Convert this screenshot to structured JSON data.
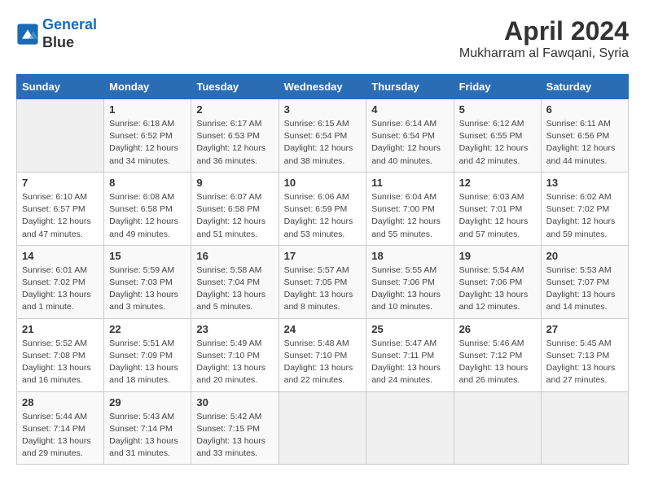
{
  "header": {
    "logo_line1": "General",
    "logo_line2": "Blue",
    "month": "April 2024",
    "location": "Mukharram al Fawqani, Syria"
  },
  "columns": [
    "Sunday",
    "Monday",
    "Tuesday",
    "Wednesday",
    "Thursday",
    "Friday",
    "Saturday"
  ],
  "weeks": [
    [
      {
        "day": "",
        "info": ""
      },
      {
        "day": "1",
        "info": "Sunrise: 6:18 AM\nSunset: 6:52 PM\nDaylight: 12 hours\nand 34 minutes."
      },
      {
        "day": "2",
        "info": "Sunrise: 6:17 AM\nSunset: 6:53 PM\nDaylight: 12 hours\nand 36 minutes."
      },
      {
        "day": "3",
        "info": "Sunrise: 6:15 AM\nSunset: 6:54 PM\nDaylight: 12 hours\nand 38 minutes."
      },
      {
        "day": "4",
        "info": "Sunrise: 6:14 AM\nSunset: 6:54 PM\nDaylight: 12 hours\nand 40 minutes."
      },
      {
        "day": "5",
        "info": "Sunrise: 6:12 AM\nSunset: 6:55 PM\nDaylight: 12 hours\nand 42 minutes."
      },
      {
        "day": "6",
        "info": "Sunrise: 6:11 AM\nSunset: 6:56 PM\nDaylight: 12 hours\nand 44 minutes."
      }
    ],
    [
      {
        "day": "7",
        "info": "Sunrise: 6:10 AM\nSunset: 6:57 PM\nDaylight: 12 hours\nand 47 minutes."
      },
      {
        "day": "8",
        "info": "Sunrise: 6:08 AM\nSunset: 6:58 PM\nDaylight: 12 hours\nand 49 minutes."
      },
      {
        "day": "9",
        "info": "Sunrise: 6:07 AM\nSunset: 6:58 PM\nDaylight: 12 hours\nand 51 minutes."
      },
      {
        "day": "10",
        "info": "Sunrise: 6:06 AM\nSunset: 6:59 PM\nDaylight: 12 hours\nand 53 minutes."
      },
      {
        "day": "11",
        "info": "Sunrise: 6:04 AM\nSunset: 7:00 PM\nDaylight: 12 hours\nand 55 minutes."
      },
      {
        "day": "12",
        "info": "Sunrise: 6:03 AM\nSunset: 7:01 PM\nDaylight: 12 hours\nand 57 minutes."
      },
      {
        "day": "13",
        "info": "Sunrise: 6:02 AM\nSunset: 7:02 PM\nDaylight: 12 hours\nand 59 minutes."
      }
    ],
    [
      {
        "day": "14",
        "info": "Sunrise: 6:01 AM\nSunset: 7:02 PM\nDaylight: 13 hours\nand 1 minute."
      },
      {
        "day": "15",
        "info": "Sunrise: 5:59 AM\nSunset: 7:03 PM\nDaylight: 13 hours\nand 3 minutes."
      },
      {
        "day": "16",
        "info": "Sunrise: 5:58 AM\nSunset: 7:04 PM\nDaylight: 13 hours\nand 5 minutes."
      },
      {
        "day": "17",
        "info": "Sunrise: 5:57 AM\nSunset: 7:05 PM\nDaylight: 13 hours\nand 8 minutes."
      },
      {
        "day": "18",
        "info": "Sunrise: 5:55 AM\nSunset: 7:06 PM\nDaylight: 13 hours\nand 10 minutes."
      },
      {
        "day": "19",
        "info": "Sunrise: 5:54 AM\nSunset: 7:06 PM\nDaylight: 13 hours\nand 12 minutes."
      },
      {
        "day": "20",
        "info": "Sunrise: 5:53 AM\nSunset: 7:07 PM\nDaylight: 13 hours\nand 14 minutes."
      }
    ],
    [
      {
        "day": "21",
        "info": "Sunrise: 5:52 AM\nSunset: 7:08 PM\nDaylight: 13 hours\nand 16 minutes."
      },
      {
        "day": "22",
        "info": "Sunrise: 5:51 AM\nSunset: 7:09 PM\nDaylight: 13 hours\nand 18 minutes."
      },
      {
        "day": "23",
        "info": "Sunrise: 5:49 AM\nSunset: 7:10 PM\nDaylight: 13 hours\nand 20 minutes."
      },
      {
        "day": "24",
        "info": "Sunrise: 5:48 AM\nSunset: 7:10 PM\nDaylight: 13 hours\nand 22 minutes."
      },
      {
        "day": "25",
        "info": "Sunrise: 5:47 AM\nSunset: 7:11 PM\nDaylight: 13 hours\nand 24 minutes."
      },
      {
        "day": "26",
        "info": "Sunrise: 5:46 AM\nSunset: 7:12 PM\nDaylight: 13 hours\nand 26 minutes."
      },
      {
        "day": "27",
        "info": "Sunrise: 5:45 AM\nSunset: 7:13 PM\nDaylight: 13 hours\nand 27 minutes."
      }
    ],
    [
      {
        "day": "28",
        "info": "Sunrise: 5:44 AM\nSunset: 7:14 PM\nDaylight: 13 hours\nand 29 minutes."
      },
      {
        "day": "29",
        "info": "Sunrise: 5:43 AM\nSunset: 7:14 PM\nDaylight: 13 hours\nand 31 minutes."
      },
      {
        "day": "30",
        "info": "Sunrise: 5:42 AM\nSunset: 7:15 PM\nDaylight: 13 hours\nand 33 minutes."
      },
      {
        "day": "",
        "info": ""
      },
      {
        "day": "",
        "info": ""
      },
      {
        "day": "",
        "info": ""
      },
      {
        "day": "",
        "info": ""
      }
    ]
  ]
}
